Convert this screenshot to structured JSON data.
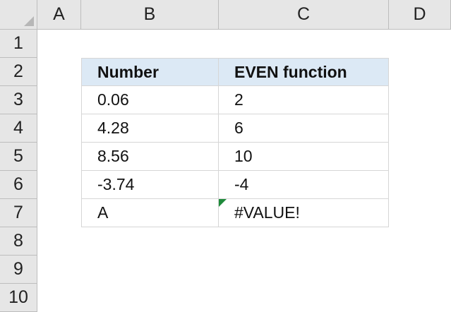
{
  "columns": [
    "A",
    "B",
    "C",
    "D"
  ],
  "rows": [
    "1",
    "2",
    "3",
    "4",
    "5",
    "6",
    "7",
    "8",
    "9",
    "10"
  ],
  "table": {
    "headers": [
      "Number",
      "EVEN function"
    ],
    "rows": [
      [
        "0.06",
        "2"
      ],
      [
        "4.28",
        "6"
      ],
      [
        "8.56",
        "10"
      ],
      [
        "-3.74",
        "-4"
      ],
      [
        "A",
        "#VALUE!"
      ]
    ]
  },
  "colors": {
    "header_fill": "#dce9f5",
    "error_indicator": "#1f8a3b"
  }
}
